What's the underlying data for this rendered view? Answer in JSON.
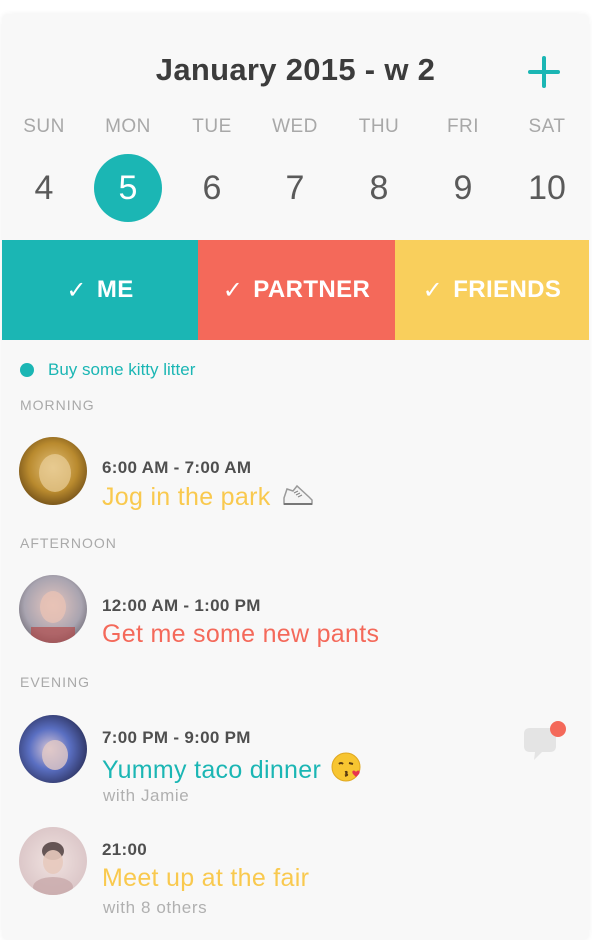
{
  "header": {
    "title": "January 2015  - w 2",
    "add_icon": "plus-icon"
  },
  "week": {
    "day_labels": [
      "SUN",
      "MON",
      "TUE",
      "WED",
      "THU",
      "FRI",
      "SAT"
    ],
    "dates": [
      "4",
      "5",
      "6",
      "7",
      "8",
      "9",
      "10"
    ],
    "selected_date": "5"
  },
  "filters": [
    {
      "label": "ME",
      "color": "#1bb6b4",
      "check_icon": "checkmark-icon"
    },
    {
      "label": "PARTNER",
      "color": "#f4695a",
      "check_icon": "checkmark-icon"
    },
    {
      "label": "FRIENDS",
      "color": "#f9cf5c",
      "check_icon": "checkmark-icon"
    }
  ],
  "reminder": {
    "text": "Buy some kitty litter",
    "color": "#1bb6b4"
  },
  "sections": {
    "morning": "MORNING",
    "afternoon": "AFTERNOON",
    "evening": "EVENING"
  },
  "events": [
    {
      "time": "6:00 AM - 7:00 AM",
      "title": "Jog in the park",
      "emoji": "sneaker-emoji",
      "color": "#f9c94e",
      "subtitle": ""
    },
    {
      "time": "12:00 AM - 1:00 PM",
      "title": "Get me some new pants",
      "emoji": "",
      "color": "#f4695a",
      "subtitle": ""
    },
    {
      "time": "7:00 PM - 9:00 PM",
      "title": "Yummy taco dinner",
      "emoji": "kissing-face-emoji",
      "color": "#1bb6b4",
      "subtitle": "with Jamie",
      "has_comment": true
    },
    {
      "time": "21:00",
      "title": "Meet up at the fair",
      "emoji": "",
      "color": "#f9c94e",
      "subtitle": "with 8 others"
    }
  ],
  "colors": {
    "teal": "#1bb6b4",
    "coral": "#f4695a",
    "yellow": "#f9cf5c"
  }
}
